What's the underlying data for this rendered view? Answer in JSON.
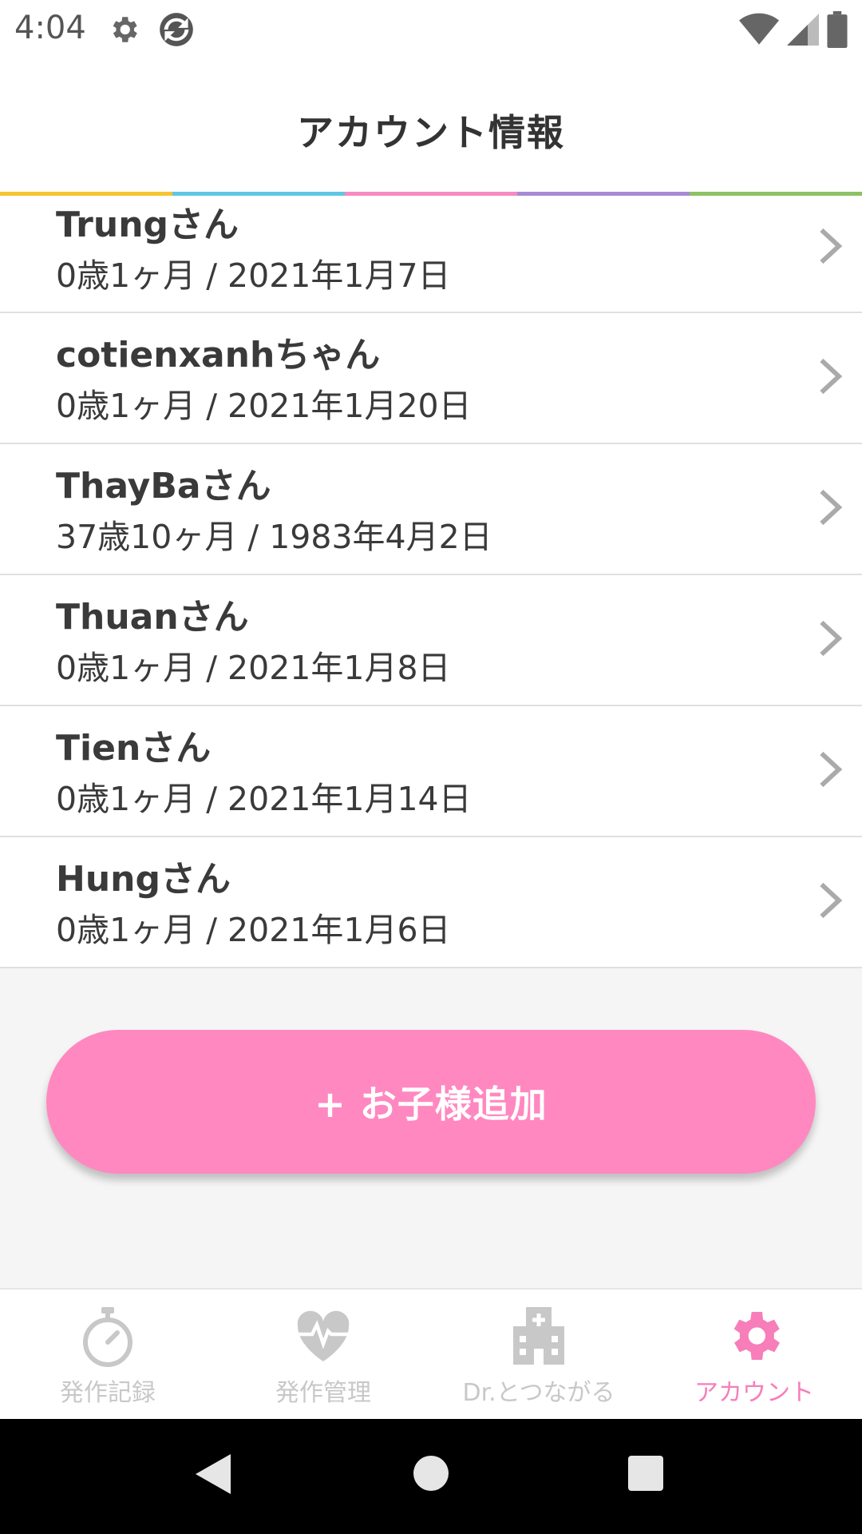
{
  "status_bar": {
    "time": "4:04",
    "icons": [
      "gear-icon",
      "sync-icon",
      "wifi-icon",
      "signal-icon",
      "battery-icon"
    ]
  },
  "header": {
    "title": "アカウント情報",
    "rainbow_colors": [
      "#f7c531",
      "#5ec7e3",
      "#f78ac0",
      "#a88ad6",
      "#8cc265"
    ]
  },
  "children": [
    {
      "name": "Trungさん",
      "info": "0歳1ヶ月 / 2021年1月7日"
    },
    {
      "name": "cotienxanhちゃん",
      "info": "0歳1ヶ月 / 2021年1月20日"
    },
    {
      "name": "ThayBaさん",
      "info": "37歳10ヶ月 / 1983年4月2日"
    },
    {
      "name": "Thuanさん",
      "info": "0歳1ヶ月 / 2021年1月8日"
    },
    {
      "name": "Tienさん",
      "info": "0歳1ヶ月 / 2021年1月14日"
    },
    {
      "name": "Hungさん",
      "info": "0歳1ヶ月 / 2021年1月6日"
    }
  ],
  "add_button": {
    "label": "+ お子様追加",
    "color": "#ff88c0"
  },
  "bottom_nav": {
    "items": [
      {
        "label": "発作記録",
        "icon": "stopwatch-icon",
        "active": false
      },
      {
        "label": "発作管理",
        "icon": "heartbeat-icon",
        "active": false
      },
      {
        "label": "Dr.とつながる",
        "icon": "hospital-icon",
        "active": false
      },
      {
        "label": "アカウント",
        "icon": "gear-icon",
        "active": true
      }
    ],
    "active_color": "#f77eb9",
    "inactive_color": "#c8c8c8"
  },
  "android_nav": {
    "icons": [
      "back-icon",
      "home-icon",
      "recents-icon"
    ]
  }
}
